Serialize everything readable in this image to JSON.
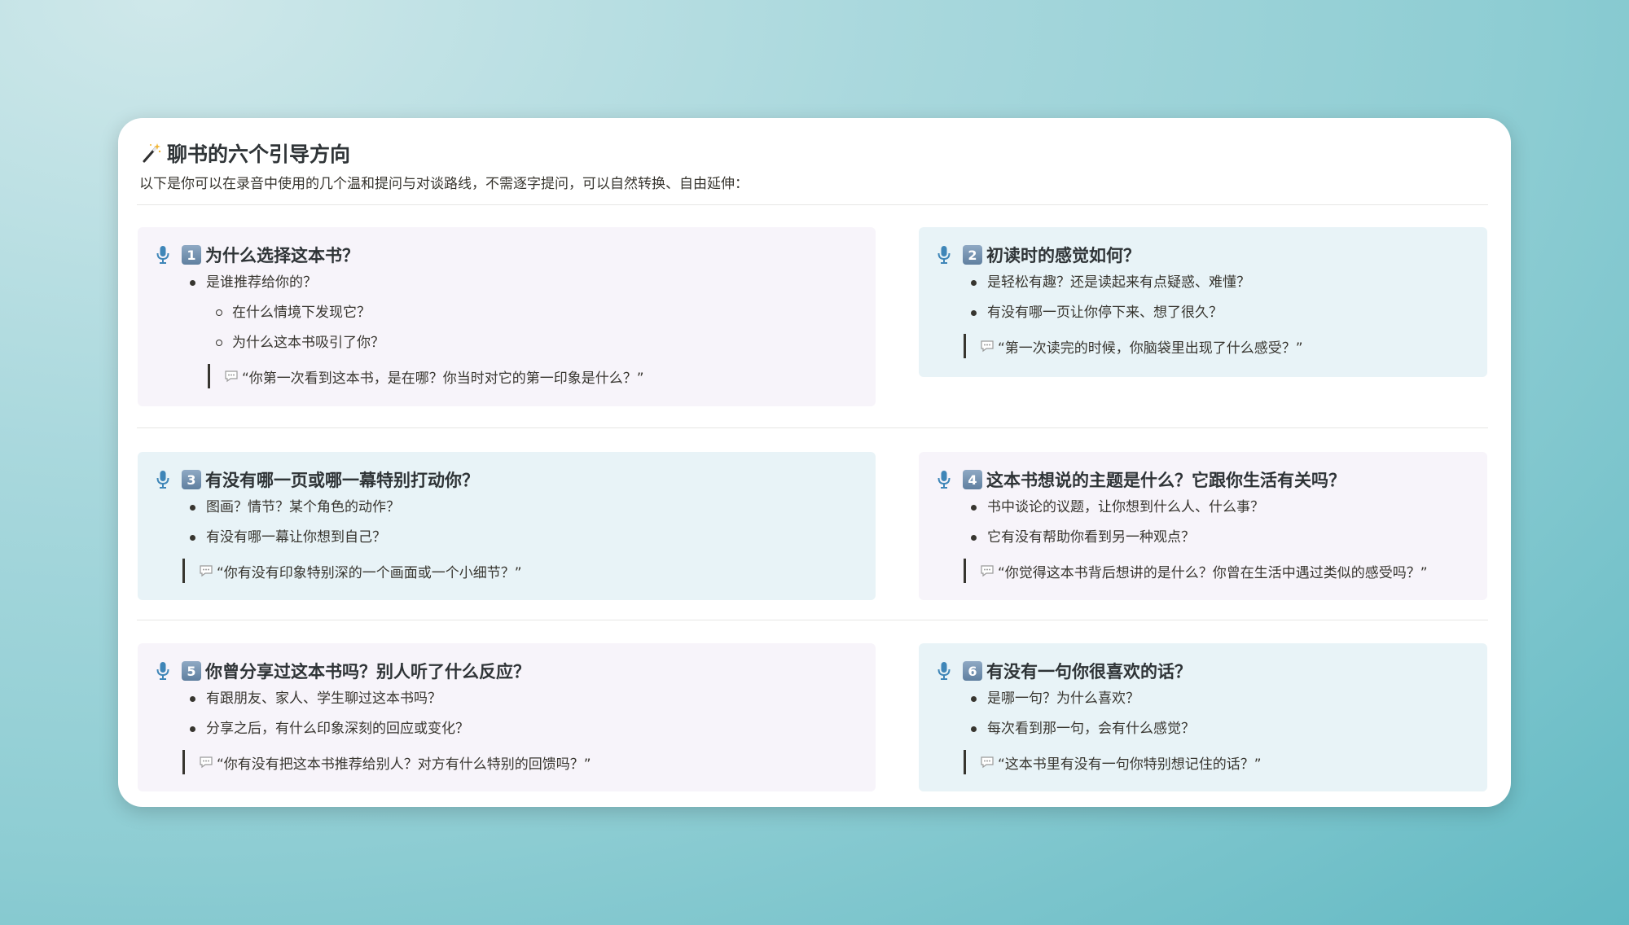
{
  "page": {
    "title": "聊书的六个引导方向",
    "subtitle": "以下是你可以在录音中使用的几个温和提问与对谈路线，不需逐字提问，可以自然转换、自由延伸：",
    "title_icon": "magic-wand-icon"
  },
  "colors": {
    "purple_block": "#f7f4fa",
    "blue_block": "#e8f3f7",
    "mic": "#3f86b8"
  },
  "sections": [
    {
      "number": "1",
      "heading": "为什么选择这本书？",
      "bullets": [
        {
          "text": "是谁推荐给你的？",
          "sub": [
            "在什么情境下发现它？",
            "为什么这本书吸引了你？"
          ]
        }
      ],
      "quote": "“你第一次看到这本书，是在哪？你当时对它的第一印象是什么？”"
    },
    {
      "number": "2",
      "heading": "初读时的感觉如何？",
      "bullets": [
        {
          "text": "是轻松有趣？还是读起来有点疑惑、难懂？"
        },
        {
          "text": "有没有哪一页让你停下来、想了很久？"
        }
      ],
      "quote": "“第一次读完的时候，你脑袋里出现了什么感受？”"
    },
    {
      "number": "3",
      "heading": "有没有哪一页或哪一幕特别打动你？",
      "bullets": [
        {
          "text": "图画？情节？某个角色的动作？"
        },
        {
          "text": "有没有哪一幕让你想到自己？"
        }
      ],
      "quote": "“你有没有印象特别深的一个画面或一个小细节？”"
    },
    {
      "number": "4",
      "heading": "这本书想说的主题是什么？它跟你生活有关吗？",
      "bullets": [
        {
          "text": "书中谈论的议题，让你想到什么人、什么事？"
        },
        {
          "text": "它有没有帮助你看到另一种观点？"
        }
      ],
      "quote": "“你觉得这本书背后想讲的是什么？你曾在生活中遇过类似的感受吗？”"
    },
    {
      "number": "5",
      "heading": "你曾分享过这本书吗？别人听了什么反应？",
      "bullets": [
        {
          "text": "有跟朋友、家人、学生聊过这本书吗？"
        },
        {
          "text": "分享之后，有什么印象深刻的回应或变化？"
        }
      ],
      "quote": "“你有没有把这本书推荐给别人？对方有什么特别的回馈吗？”"
    },
    {
      "number": "6",
      "heading": "有没有一句你很喜欢的话？",
      "bullets": [
        {
          "text": "是哪一句？为什么喜欢？"
        },
        {
          "text": "每次看到那一句，会有什么感觉？"
        }
      ],
      "quote": "“这本书里有没有一句你特别想记住的话？”"
    }
  ]
}
